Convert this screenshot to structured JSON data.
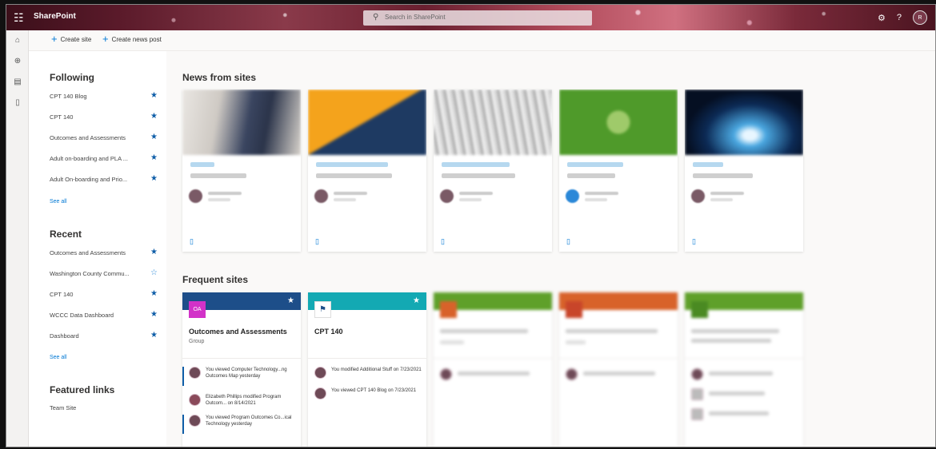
{
  "suitebar": {
    "brand": "SharePoint",
    "search_placeholder": "Search in SharePoint",
    "settings_icon": "gear-icon",
    "help_label": "?",
    "avatar_initials": "R"
  },
  "commands": {
    "create_site": "Create site",
    "create_news": "Create news post"
  },
  "leftnav": {
    "following_title": "Following",
    "following": [
      {
        "label": "CPT 140 Blog"
      },
      {
        "label": "CPT 140"
      },
      {
        "label": "Outcomes and Assessments"
      },
      {
        "label": "Adult on-boarding and PLA ..."
      },
      {
        "label": "Adult On-boarding and Prio..."
      }
    ],
    "see_all_1": "See all",
    "recent_title": "Recent",
    "recent": [
      {
        "label": "Outcomes and Assessments",
        "star": "filled"
      },
      {
        "label": "Washington County Commu...",
        "star": "outline"
      },
      {
        "label": "CPT 140",
        "star": "filled"
      },
      {
        "label": "WCCC Data Dashboard",
        "star": "filled"
      },
      {
        "label": "Dashboard",
        "star": "filled"
      }
    ],
    "see_all_2": "See all",
    "featured_title": "Featured links",
    "featured": [
      {
        "label": "Team Site"
      }
    ]
  },
  "main": {
    "news_title": "News from sites",
    "frequent_title": "Frequent sites",
    "sites": [
      {
        "name": "Outcomes and Assessments",
        "type": "Group",
        "logo": "OA",
        "activities": [
          {
            "text": "You viewed Computer Technology...ng Outcomes Map yesterday"
          },
          {
            "text": "Elizabeth Phillips modified Program Outcom... on 8/14/2021"
          },
          {
            "text": "You viewed Program Outcomes Co...ical Technology yesterday"
          }
        ]
      },
      {
        "name": "CPT 140",
        "activities": [
          {
            "text": "You modified Additional Stuff on 7/23/2021"
          },
          {
            "text": "You viewed CPT 140 Blog on 7/23/2021"
          }
        ]
      }
    ]
  },
  "colors": {
    "accent": "#0078d4",
    "star": "#0f5ea8",
    "oa_header": "#1d4e89",
    "oa_logo": "#d232c8",
    "cpt_header": "#13a9b3",
    "green_header": "#5fa02a",
    "orange_header": "#d8622a"
  }
}
